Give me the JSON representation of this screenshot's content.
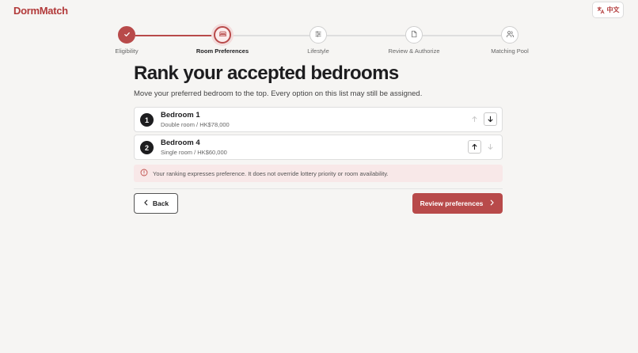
{
  "app": {
    "logo": "DormMatch",
    "language_label": "中文"
  },
  "stepper": {
    "steps": [
      {
        "label": "Eligibility",
        "state": "done",
        "icon": "check-icon"
      },
      {
        "label": "Room Preferences",
        "state": "current",
        "icon": "bed-icon"
      },
      {
        "label": "Lifestyle",
        "state": "upcoming",
        "icon": "sliders-icon"
      },
      {
        "label": "Review & Authorize",
        "state": "upcoming",
        "icon": "document-icon"
      },
      {
        "label": "Matching Pool",
        "state": "upcoming",
        "icon": "users-icon"
      }
    ]
  },
  "main": {
    "title": "Rank your accepted bedrooms",
    "subtitle": "Move your preferred bedroom to the top. Every option on this list may still be assigned.",
    "rooms": [
      {
        "rank": "1",
        "name": "Bedroom 1",
        "detail": "Double room / HK$78,000",
        "can_move_up": false,
        "can_move_down": true
      },
      {
        "rank": "2",
        "name": "Bedroom 4",
        "detail": "Single room / HK$60,000",
        "can_move_up": true,
        "can_move_down": false
      }
    ],
    "notice": "Your ranking expresses preference. It does not override lottery priority or room availability."
  },
  "actions": {
    "back_label": "Back",
    "review_label": "Review preferences"
  },
  "colors": {
    "accent": "#b84a4a",
    "background": "#f6f5f3",
    "notice_bg": "#f8e8e8"
  }
}
